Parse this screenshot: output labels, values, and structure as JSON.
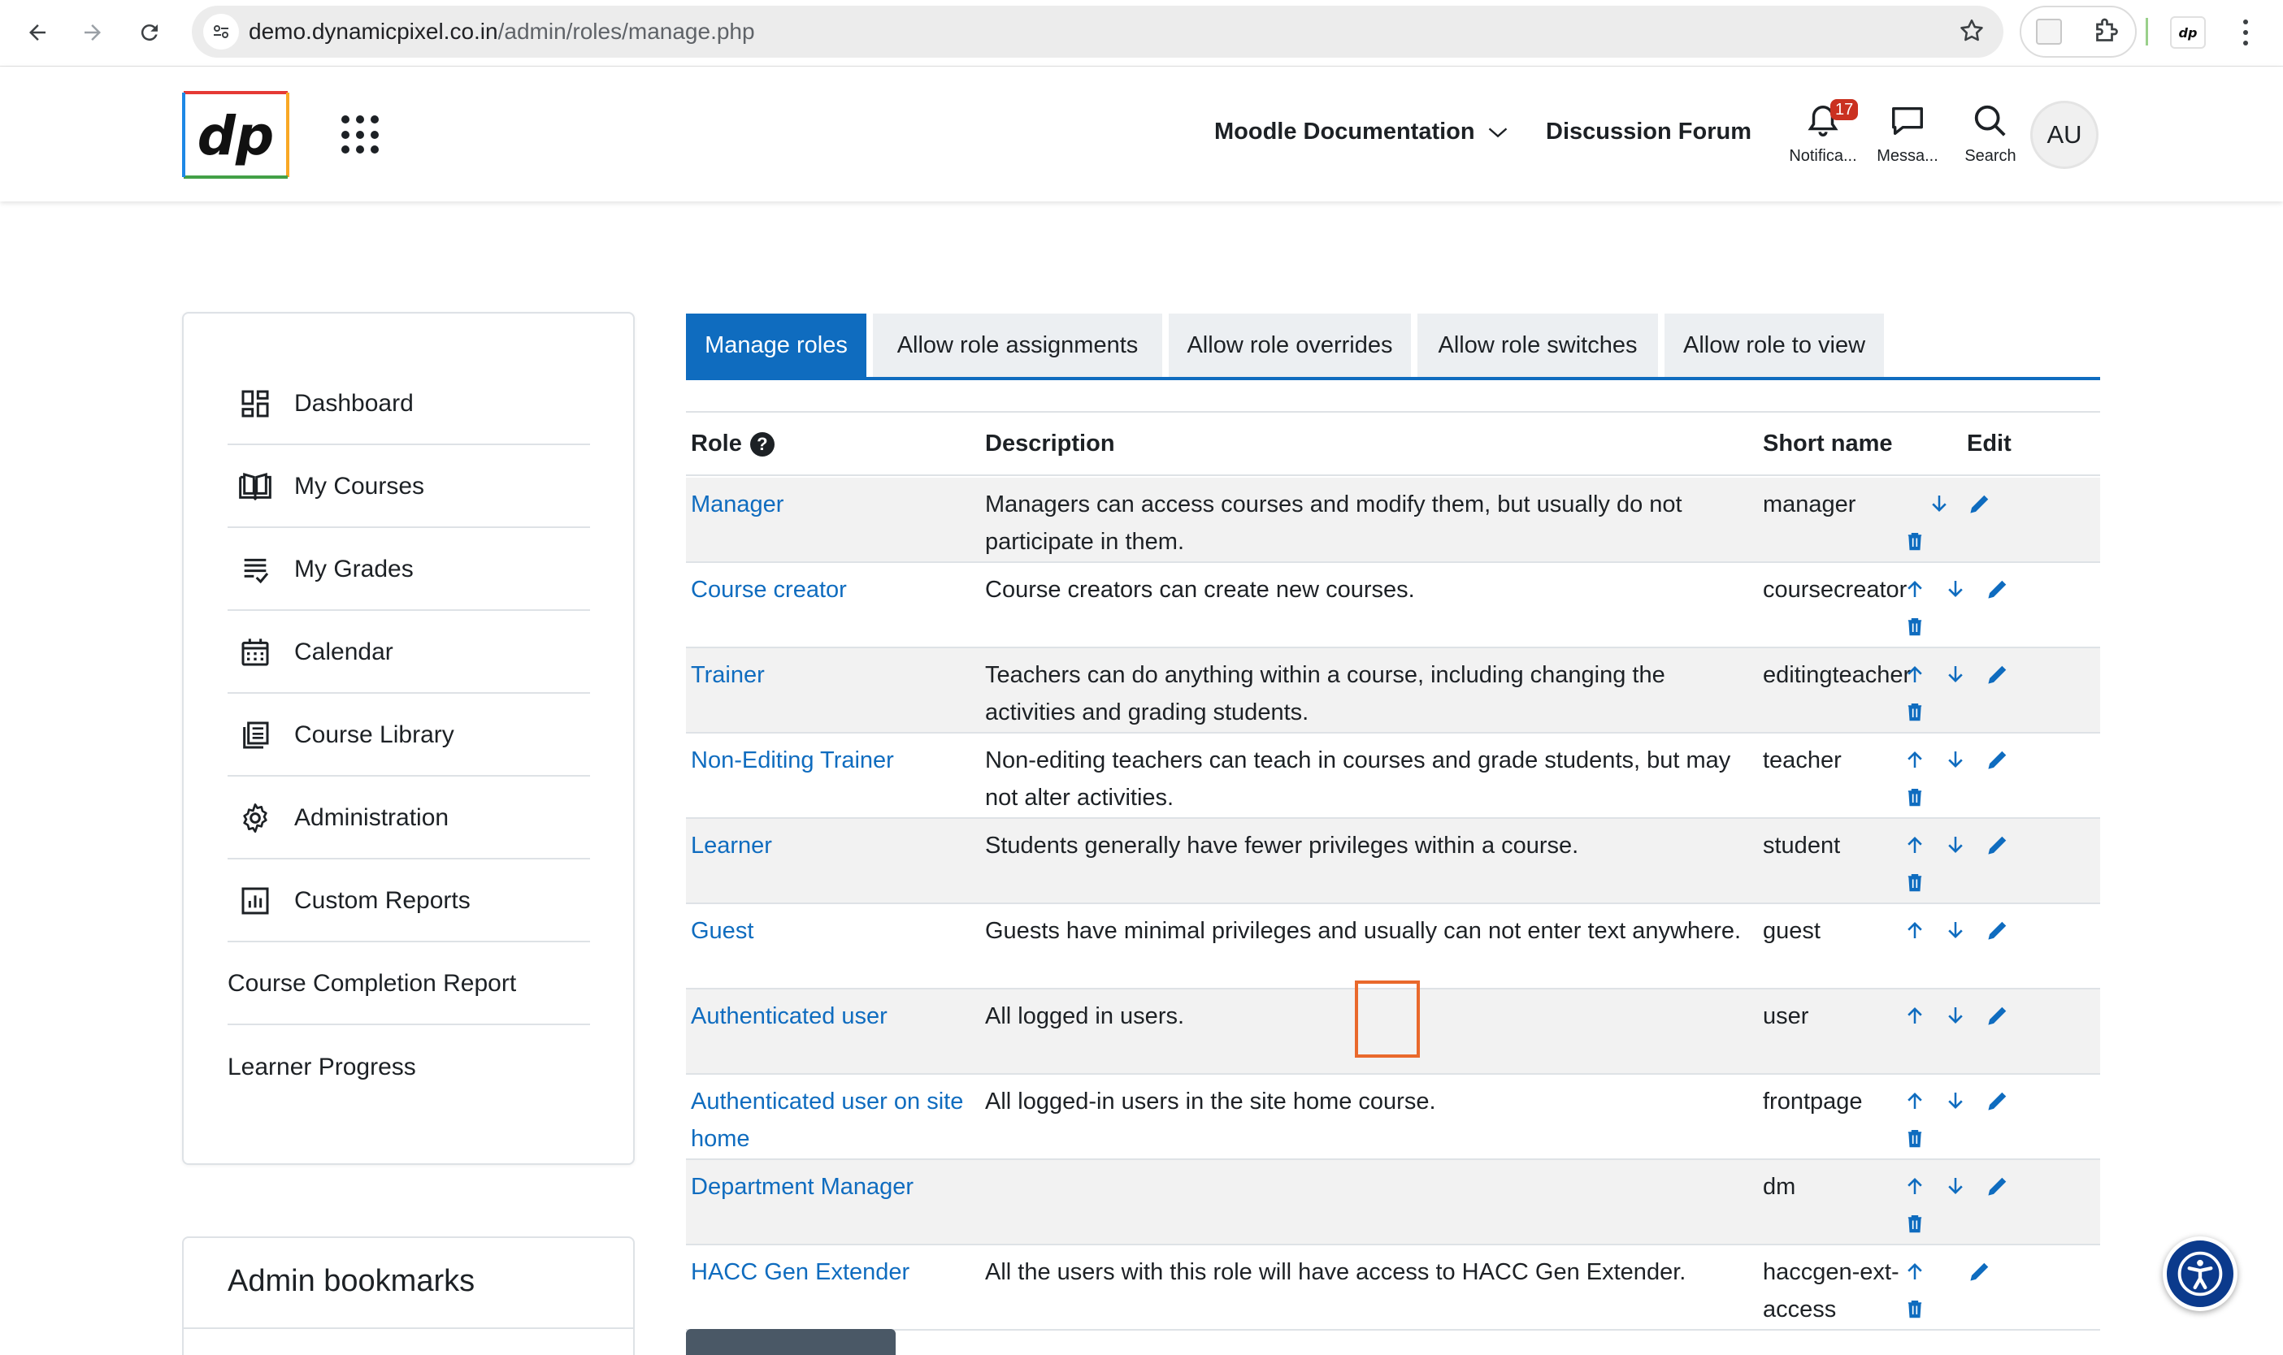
{
  "browser": {
    "url_host": "demo.dynamicpixel.co.in",
    "url_path": "/admin/roles/manage.php"
  },
  "header": {
    "logo_text": "dp",
    "nav": {
      "documentation": "Moodle Documentation",
      "forum": "Discussion Forum"
    },
    "notifications_label": "Notifica...",
    "notifications_count": "17",
    "messages_label": "Messa...",
    "search_label": "Search",
    "avatar_initials": "AU"
  },
  "sidebar": {
    "items": [
      {
        "label": "Dashboard",
        "icon": "dashboard-icon"
      },
      {
        "label": "My Courses",
        "icon": "book-icon"
      },
      {
        "label": "My Grades",
        "icon": "grades-icon"
      },
      {
        "label": "Calendar",
        "icon": "calendar-icon"
      },
      {
        "label": "Course Library",
        "icon": "library-icon"
      },
      {
        "label": "Administration",
        "icon": "gear-icon"
      },
      {
        "label": "Custom Reports",
        "icon": "report-icon"
      },
      {
        "label": "Course Completion Report",
        "icon": ""
      },
      {
        "label": "Learner Progress",
        "icon": ""
      }
    ],
    "bookmarks_title": "Admin bookmarks"
  },
  "tabs": [
    {
      "label": "Manage roles",
      "active": true
    },
    {
      "label": "Allow role assignments",
      "active": false
    },
    {
      "label": "Allow role overrides",
      "active": false
    },
    {
      "label": "Allow role switches",
      "active": false
    },
    {
      "label": "Allow role to view",
      "active": false
    }
  ],
  "table": {
    "headers": {
      "role": "Role",
      "description": "Description",
      "short_name": "Short name",
      "edit": "Edit"
    },
    "help_glyph": "?",
    "rows": [
      {
        "role": "Manager",
        "description": "Managers can access courses and modify them, but usually do not participate in them.",
        "short_name": "manager",
        "up": false,
        "down": true,
        "delete": true
      },
      {
        "role": "Course creator",
        "description": "Course creators can create new courses.",
        "short_name": "coursecreator",
        "up": true,
        "down": true,
        "delete": true
      },
      {
        "role": "Trainer",
        "description": "Teachers can do anything within a course, including changing the activities and grading students.",
        "short_name": "editingteacher",
        "up": true,
        "down": true,
        "delete": true
      },
      {
        "role": "Non-Editing Trainer",
        "description": "Non-editing teachers can teach in courses and grade students, but may not alter activities.",
        "short_name": "teacher",
        "up": true,
        "down": true,
        "delete": true
      },
      {
        "role": "Learner",
        "description": "Students generally have fewer privileges within a course.",
        "short_name": "student",
        "up": true,
        "down": true,
        "delete": true
      },
      {
        "role": "Guest",
        "description": "Guests have minimal privileges and usually can not enter text anywhere.",
        "short_name": "guest",
        "up": true,
        "down": true,
        "delete": false
      },
      {
        "role": "Authenticated user",
        "description": "All logged in users.",
        "short_name": "user",
        "up": true,
        "down": true,
        "delete": false
      },
      {
        "role": "Authenticated user on site home",
        "description": "All logged-in users in the site home course.",
        "short_name": "frontpage",
        "up": true,
        "down": true,
        "delete": true
      },
      {
        "role": "Department Manager",
        "description": "",
        "short_name": "dm",
        "up": true,
        "down": true,
        "delete": true
      },
      {
        "role": "HACC Gen Extender",
        "description": "All the users with this role will have access to HACC Gen Extender.",
        "short_name": "haccgen-ext-access",
        "up": true,
        "down": false,
        "delete": true
      }
    ]
  },
  "colors": {
    "primary": "#0f6cbf",
    "highlight": "#e9692c",
    "badge": "#ca3120"
  }
}
